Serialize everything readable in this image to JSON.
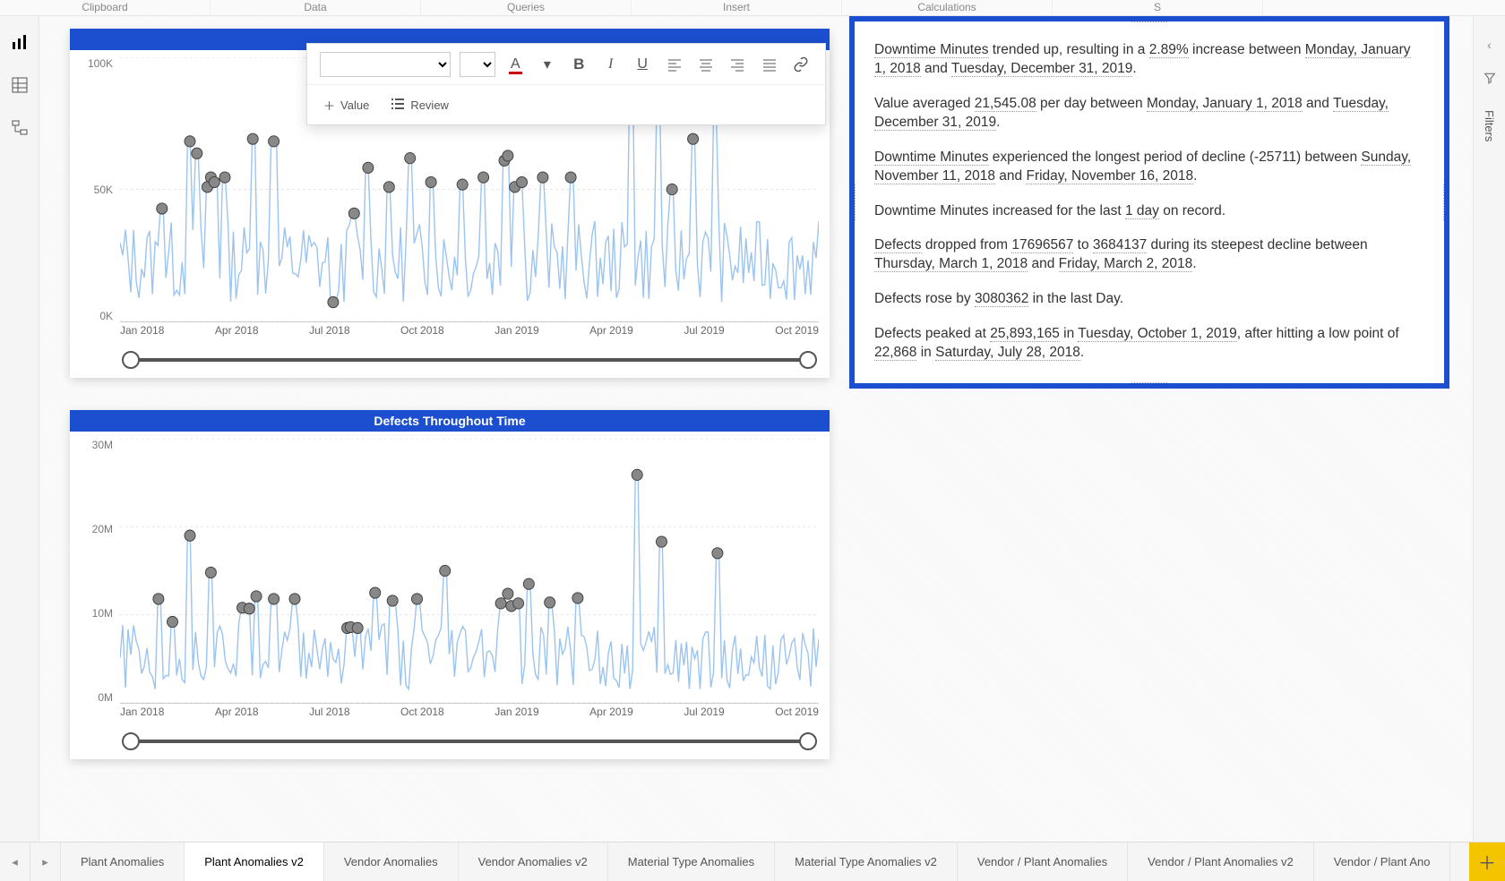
{
  "ribbon_groups": [
    "Clipboard",
    "Data",
    "Queries",
    "Insert",
    "Calculations",
    "S"
  ],
  "left_nav": {
    "items": [
      {
        "name": "report-view",
        "active": true
      },
      {
        "name": "data-view",
        "active": false
      },
      {
        "name": "model-view",
        "active": false
      }
    ]
  },
  "right_pane": {
    "collapse_label_filters": "Filters"
  },
  "toolbar": {
    "value_label": "Value",
    "review_label": "Review",
    "bold": "B",
    "italic": "I",
    "underline": "U",
    "font_color_letter": "A"
  },
  "narrative": {
    "lines": [
      [
        {
          "t": "Downtime Minutes",
          "u": true
        },
        {
          "t": " trended up, resulting in a "
        },
        {
          "t": "2.89%",
          "u": true
        },
        {
          "t": " increase between "
        },
        {
          "t": "Monday, January 1, 2018",
          "u": true
        },
        {
          "t": " and "
        },
        {
          "t": "Tuesday, December 31, 2019",
          "u": true
        },
        {
          "t": "."
        }
      ],
      [
        {
          "t": "Value averaged "
        },
        {
          "t": "21,545.08",
          "u": true
        },
        {
          "t": " per day between "
        },
        {
          "t": "Monday, January 1, 2018",
          "u": true
        },
        {
          "t": " and "
        },
        {
          "t": "Tuesday, December 31, 2019",
          "u": true
        },
        {
          "t": "."
        }
      ],
      [
        {
          "t": "Downtime Minutes",
          "u": true
        },
        {
          "t": " experienced the longest period of decline (-25711) between "
        },
        {
          "t": "Sunday, November 11, 2018",
          "u": true
        },
        {
          "t": " and "
        },
        {
          "t": "Friday, November 16, 2018",
          "u": true
        },
        {
          "t": "."
        }
      ],
      [
        {
          "t": "Downtime Minutes increased for the last "
        },
        {
          "t": "1 day",
          "u": true
        },
        {
          "t": " on record."
        }
      ],
      [
        {
          "t": "Defects",
          "u": true
        },
        {
          "t": " dropped from "
        },
        {
          "t": "17696567",
          "u": true
        },
        {
          "t": " to "
        },
        {
          "t": "3684137",
          "u": true
        },
        {
          "t": " during its steepest decline between "
        },
        {
          "t": "Thursday, March 1, 2018",
          "u": true
        },
        {
          "t": " and "
        },
        {
          "t": "Friday, March 2, 2018",
          "u": true
        },
        {
          "t": "."
        }
      ],
      [
        {
          "t": "Defects rose by "
        },
        {
          "t": "3080362",
          "u": true
        },
        {
          "t": " in the last Day."
        }
      ],
      [
        {
          "t": "Defects peaked at "
        },
        {
          "t": "25,893,165",
          "u": true
        },
        {
          "t": " in "
        },
        {
          "t": "Tuesday, October 1, 2019",
          "u": true
        },
        {
          "t": ", after hitting a low point of "
        },
        {
          "t": "22,868",
          "u": true
        },
        {
          "t": " in "
        },
        {
          "t": "Saturday, July 28, 2018",
          "u": true
        },
        {
          "t": "."
        }
      ]
    ]
  },
  "chart_data": [
    {
      "type": "line",
      "title": "",
      "xlabel": "",
      "ylabel": "",
      "y_ticks": [
        "100K",
        "50K",
        "0K"
      ],
      "ylim": [
        0,
        110000
      ],
      "x_ticks": [
        "Jan 2018",
        "Apr 2018",
        "Jul 2018",
        "Oct 2018",
        "Jan 2019",
        "Apr 2019",
        "Jul 2019",
        "Oct 2019"
      ],
      "series": [
        {
          "name": "Downtime Minutes",
          "noise_min": 8000,
          "noise_max": 42000
        }
      ],
      "anomalies": [
        {
          "x": 0.06,
          "y": 47000
        },
        {
          "x": 0.1,
          "y": 75000
        },
        {
          "x": 0.11,
          "y": 70000
        },
        {
          "x": 0.125,
          "y": 56000
        },
        {
          "x": 0.13,
          "y": 60000
        },
        {
          "x": 0.135,
          "y": 58000
        },
        {
          "x": 0.15,
          "y": 60000
        },
        {
          "x": 0.19,
          "y": 76000
        },
        {
          "x": 0.22,
          "y": 75000
        },
        {
          "x": 0.305,
          "y": 8000
        },
        {
          "x": 0.335,
          "y": 45000
        },
        {
          "x": 0.355,
          "y": 64000
        },
        {
          "x": 0.385,
          "y": 56000
        },
        {
          "x": 0.415,
          "y": 68000
        },
        {
          "x": 0.445,
          "y": 58000
        },
        {
          "x": 0.49,
          "y": 57000
        },
        {
          "x": 0.52,
          "y": 60000
        },
        {
          "x": 0.55,
          "y": 67000
        },
        {
          "x": 0.555,
          "y": 69000
        },
        {
          "x": 0.565,
          "y": 56000
        },
        {
          "x": 0.575,
          "y": 58000
        },
        {
          "x": 0.605,
          "y": 60000
        },
        {
          "x": 0.645,
          "y": 60000
        },
        {
          "x": 0.77,
          "y": 95000
        },
        {
          "x": 0.79,
          "y": 55000
        },
        {
          "x": 0.82,
          "y": 76000
        },
        {
          "x": 0.85,
          "y": 85000
        },
        {
          "x": 0.73,
          "y": 110000
        }
      ]
    },
    {
      "type": "line",
      "title": "Defects Throughout Time",
      "xlabel": "",
      "ylabel": "",
      "y_ticks": [
        "30M",
        "20M",
        "10M",
        "0M"
      ],
      "ylim": [
        0,
        30000000
      ],
      "x_ticks": [
        "Jan 2018",
        "Apr 2018",
        "Jul 2018",
        "Oct 2018",
        "Jan 2019",
        "Apr 2019",
        "Jul 2019",
        "Oct 2019"
      ],
      "series": [
        {
          "name": "Defects",
          "noise_min": 1500000,
          "noise_max": 9000000
        }
      ],
      "anomalies": [
        {
          "x": 0.055,
          "y": 11800000
        },
        {
          "x": 0.075,
          "y": 9200000
        },
        {
          "x": 0.1,
          "y": 19000000
        },
        {
          "x": 0.13,
          "y": 14800000
        },
        {
          "x": 0.175,
          "y": 10800000
        },
        {
          "x": 0.185,
          "y": 10700000
        },
        {
          "x": 0.195,
          "y": 12100000
        },
        {
          "x": 0.22,
          "y": 11800000
        },
        {
          "x": 0.25,
          "y": 11800000
        },
        {
          "x": 0.325,
          "y": 8500000
        },
        {
          "x": 0.33,
          "y": 8600000
        },
        {
          "x": 0.34,
          "y": 8500000
        },
        {
          "x": 0.365,
          "y": 12500000
        },
        {
          "x": 0.39,
          "y": 11600000
        },
        {
          "x": 0.425,
          "y": 11800000
        },
        {
          "x": 0.465,
          "y": 15000000
        },
        {
          "x": 0.545,
          "y": 11300000
        },
        {
          "x": 0.555,
          "y": 12400000
        },
        {
          "x": 0.56,
          "y": 11000000
        },
        {
          "x": 0.57,
          "y": 11300000
        },
        {
          "x": 0.585,
          "y": 13500000
        },
        {
          "x": 0.615,
          "y": 11400000
        },
        {
          "x": 0.655,
          "y": 11900000
        },
        {
          "x": 0.775,
          "y": 18300000
        },
        {
          "x": 0.855,
          "y": 17000000
        },
        {
          "x": 0.74,
          "y": 25893165
        }
      ]
    }
  ],
  "page_tabs": {
    "items": [
      {
        "label": "Plant Anomalies",
        "active": false
      },
      {
        "label": "Plant Anomalies v2",
        "active": true
      },
      {
        "label": "Vendor Anomalies",
        "active": false
      },
      {
        "label": "Vendor Anomalies v2",
        "active": false
      },
      {
        "label": "Material Type Anomalies",
        "active": false
      },
      {
        "label": "Material Type Anomalies v2",
        "active": false
      },
      {
        "label": "Vendor / Plant Anomalies",
        "active": false
      },
      {
        "label": "Vendor / Plant Anomalies v2",
        "active": false
      },
      {
        "label": "Vendor / Plant Ano",
        "active": false
      }
    ]
  }
}
